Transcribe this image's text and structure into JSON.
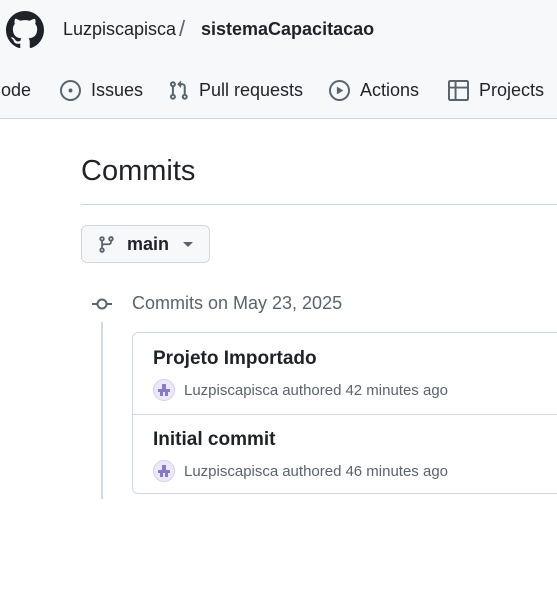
{
  "header": {
    "owner": "Luzpiscapisca",
    "separator": "/",
    "repo": "sistemaCapacitacao"
  },
  "nav": {
    "code": "Code",
    "issues": "Issues",
    "pull_requests": "Pull requests",
    "actions": "Actions",
    "projects": "Projects"
  },
  "page": {
    "title": "Commits"
  },
  "branch": {
    "name": "main"
  },
  "commit_group": {
    "heading": "Commits on May 23, 2025",
    "commits": [
      {
        "title": "Projeto Importado",
        "author": "Luzpiscapisca",
        "action": "authored",
        "time": "42 minutes ago"
      },
      {
        "title": "Initial commit",
        "author": "Luzpiscapisca",
        "action": "authored",
        "time": "46 minutes ago"
      }
    ]
  },
  "icons": {
    "logo": "github-mark-icon",
    "code": "code-icon",
    "issues": "issue-opened-icon",
    "pull_requests": "git-pull-request-icon",
    "actions": "play-icon",
    "projects": "table-icon",
    "branch": "git-branch-icon",
    "commit": "git-commit-icon"
  },
  "colors": {
    "text": "#1f2328",
    "muted": "#59636e",
    "border": "#d1d9e0",
    "header_bg": "#f6f8fa",
    "avatar_accent": "#8a79c9"
  }
}
